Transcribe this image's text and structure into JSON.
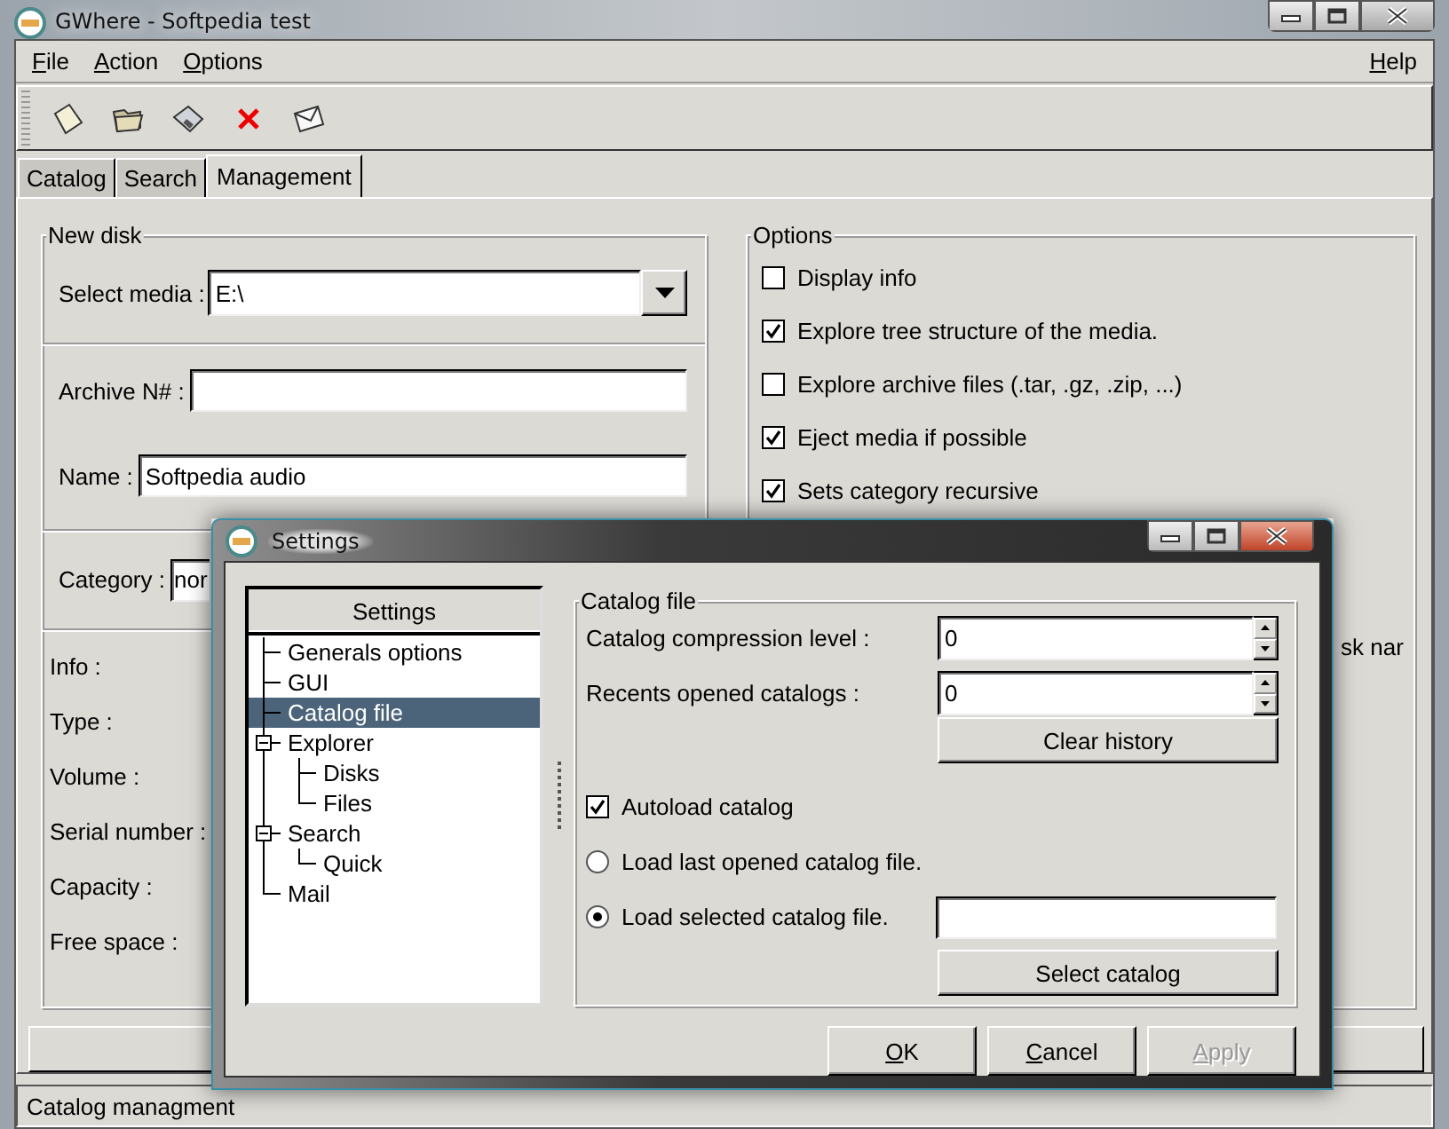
{
  "main_window": {
    "title": "GWhere - Softpedia test"
  },
  "menu": [
    {
      "label": "File"
    },
    {
      "label": "Action"
    },
    {
      "label": "Options"
    },
    {
      "label": "Help"
    }
  ],
  "tabs": [
    {
      "label": "Catalog",
      "selected": false
    },
    {
      "label": "Search",
      "selected": false
    },
    {
      "label": "Management",
      "selected": true
    }
  ],
  "new_disk": {
    "title": "New disk",
    "select_media": {
      "label": "Select media :",
      "value": "E:\\"
    },
    "archive": {
      "label": "Archive N# :"
    },
    "name": {
      "label": "Name :",
      "value": "Softpedia audio"
    },
    "category": {
      "label": "Category :",
      "value": "nor"
    },
    "info_labels": [
      "Info :",
      "Type :",
      "Volume :",
      "Serial number :",
      "Capacity :",
      "Free space :"
    ]
  },
  "options": {
    "title": "Options",
    "items": [
      {
        "label": "Display info",
        "checked": false
      },
      {
        "label": "Explore tree structure of the media.",
        "checked": true
      },
      {
        "label": "Explore archive files (.tar, .gz, .zip, ...)",
        "checked": false
      },
      {
        "label": "Eject media if possible",
        "checked": true
      },
      {
        "label": "Sets category recursive",
        "checked": true
      }
    ],
    "partial_text": "sk nar"
  },
  "status_bar": {
    "text": "Catalog managment"
  },
  "settings_dialog": {
    "title": "Settings",
    "tree": {
      "header": "Settings",
      "items": [
        {
          "label": "Generals options",
          "selected": false
        },
        {
          "label": "GUI",
          "selected": false
        },
        {
          "label": "Catalog file",
          "selected": true
        },
        {
          "label": "Explorer",
          "selected": false,
          "expanded": true,
          "children": [
            {
              "label": "Disks",
              "selected": false
            },
            {
              "label": "Files",
              "selected": false
            }
          ]
        },
        {
          "label": "Search",
          "selected": false,
          "expanded": true,
          "children": [
            {
              "label": "Quick",
              "selected": false
            }
          ]
        },
        {
          "label": "Mail",
          "selected": false
        }
      ]
    },
    "group": {
      "title": "Catalog file",
      "spins": [
        {
          "label": "Catalog compression level :",
          "value": "0"
        },
        {
          "label": "Recents opened catalogs :",
          "value": "0"
        }
      ],
      "clear_button": "Clear history",
      "autoload": {
        "label": "Autoload catalog",
        "checked": true
      },
      "radios": [
        {
          "label": "Load last opened catalog file.",
          "selected": false
        },
        {
          "label": "Load selected catalog file.",
          "selected": true
        }
      ],
      "select_button": "Select catalog"
    },
    "buttons": [
      {
        "label": "OK",
        "disabled": false
      },
      {
        "label": "Cancel",
        "disabled": false
      },
      {
        "label": "Apply",
        "disabled": true
      }
    ]
  }
}
